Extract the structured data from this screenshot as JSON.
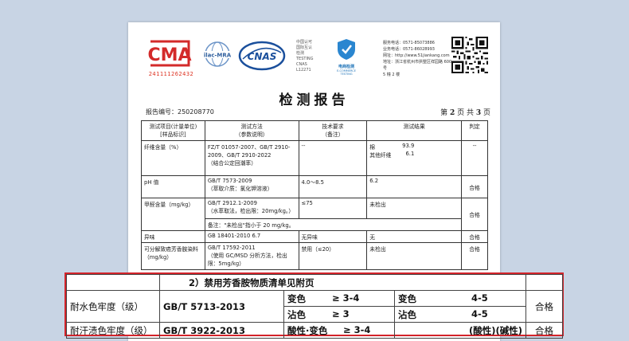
{
  "logos": {
    "cma_text": "CMA",
    "cma_number": "241111262432",
    "ilac_text": "ilac-MRA",
    "cnas_text": "CNAS",
    "lab_lines": [
      "中国认可",
      "国际互认",
      "检测",
      "TESTING",
      "CNAS L12271"
    ],
    "ecommerce_title": "电商检测",
    "ecommerce_sub": "E-COMMERCE TESTING"
  },
  "contact_lines": [
    "服务电话：0571-85073886",
    "业务电话：0571-86028993",
    "网址：http://www.51jiankang.com",
    "地址：浙江省杭州市拱墅区祥园路 600 号",
    "5 幢 2 楼"
  ],
  "document": {
    "title": "检测报告",
    "report_no_label": "报告编号：",
    "report_no": "250208770",
    "page_prefix": "第",
    "page_current": "2",
    "page_mid": "页 共",
    "page_total": "3",
    "page_suffix": "页"
  },
  "table_headers": {
    "item": "测试项目(计量单位)",
    "item_sub": "[样品标识]",
    "method": "测试方法",
    "method_sub": "（参数说明）",
    "requirement": "技术要求",
    "requirement_sub": "（备注）",
    "result": "测试结果",
    "judgement": "判定"
  },
  "rows": {
    "fiber": {
      "item": "纤维含量（%）",
      "method": "FZ/T 01057-2007、GB/T 2910-2009、GB/T 2910-2022",
      "method_note": "（结合公定回潮率）",
      "requirement": "--",
      "r1_label": "棉",
      "r1_value": "93.9",
      "r2_label": "其他纤维",
      "r2_value": "6.1",
      "judgement": "--"
    },
    "ph": {
      "item": "pH 值",
      "method": "GB/T 7573-2009",
      "method_note": "（萃取介质：氯化钾溶液）",
      "requirement": "4.0～8.5",
      "result": "6.2",
      "judgement": "合格"
    },
    "formaldehyde": {
      "item": "甲醛含量（mg/kg）",
      "method": "GB/T 2912.1-2009",
      "method_note": "（水萃取法，检出限：20mg/kg。）",
      "requirement": "≤75",
      "result": "未检出",
      "judgement": "合格",
      "remark": "备注：\"未检出\"指小于 20 mg/kg。"
    },
    "odor": {
      "item": "异味",
      "method": "GB 18401-2010 6.7",
      "requirement": "无异味",
      "result": "无",
      "judgement": "合格"
    },
    "amine": {
      "item": "可分解致癌芳香胺染料（mg/kg）",
      "method": "GB/T 17592-2011",
      "method_note": "（使用 GC/MSD 分析方法，检出限：5mg/kg）",
      "requirement": "禁用（≤20）",
      "result": "未检出",
      "judgement": "合格"
    }
  },
  "zoom": {
    "note": "2）禁用芳香胺物质清单见附页",
    "water": {
      "item": "耐水色牢度（级）",
      "method": "GB/T 5713-2013",
      "req1_label": "变色",
      "req1_value": "≥ 3-4",
      "req2_label": "沾色",
      "req2_value": "≥ 3",
      "res1_label": "变色",
      "res1_value": "4-5",
      "res2_label": "沾色",
      "res2_value": "4-5",
      "judgement": "合格"
    },
    "sweat": {
      "item": "耐汗渍色牢度（级）",
      "method": "GB/T 3922-2013",
      "req1_label": "酸性·变色",
      "req1_value": "≥ 3-4",
      "result": "(酸性)(碱性)",
      "judgement": "合格"
    }
  }
}
